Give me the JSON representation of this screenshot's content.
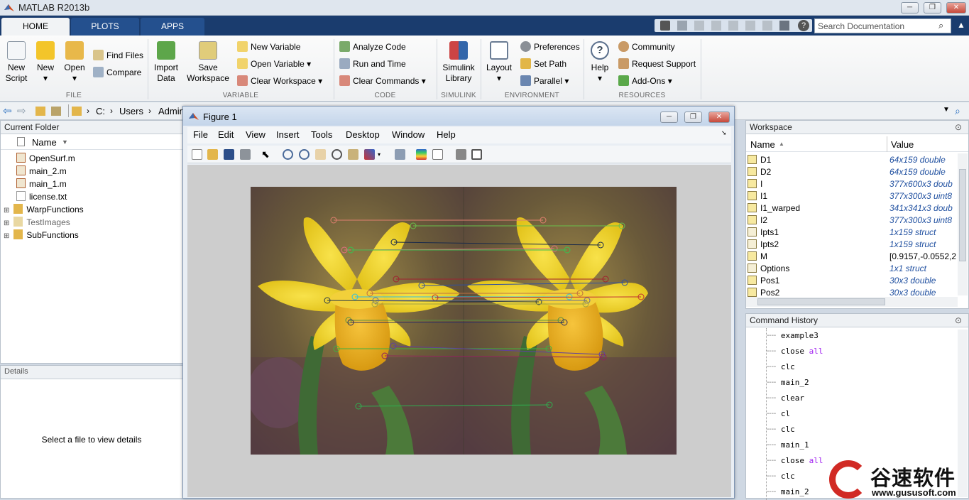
{
  "window": {
    "title": "MATLAB R2013b"
  },
  "tabs": [
    {
      "label": "HOME"
    },
    {
      "label": "PLOTS"
    },
    {
      "label": "APPS"
    }
  ],
  "search": {
    "placeholder": "Search Documentation"
  },
  "ribbon": {
    "file": {
      "new_script": "New\nScript",
      "new": "New",
      "open": "Open",
      "find_files": "Find Files",
      "compare": "Compare",
      "label": "FILE"
    },
    "variable": {
      "import_data": "Import\nData",
      "save_workspace": "Save\nWorkspace",
      "new_variable": "New Variable",
      "open_variable": "Open Variable",
      "clear_workspace": "Clear Workspace",
      "label": "VARIABLE"
    },
    "code": {
      "analyze": "Analyze Code",
      "run_time": "Run and Time",
      "clear_commands": "Clear Commands",
      "label": "CODE"
    },
    "simulink": {
      "library": "Simulink\nLibrary",
      "label": "SIMULINK"
    },
    "environment": {
      "layout": "Layout",
      "preferences": "Preferences",
      "set_path": "Set Path",
      "parallel": "Parallel",
      "label": "ENVIRONMENT"
    },
    "resources": {
      "help": "Help",
      "community": "Community",
      "request_support": "Request Support",
      "add_ons": "Add-Ons",
      "label": "RESOURCES"
    }
  },
  "address": {
    "parts": [
      "C:",
      "Users",
      "Admin"
    ]
  },
  "current_folder": {
    "title": "Current Folder",
    "col_name": "Name",
    "files": [
      {
        "name": "OpenSurf.m",
        "type": "m"
      },
      {
        "name": "main_2.m",
        "type": "m"
      },
      {
        "name": "main_1.m",
        "type": "m"
      },
      {
        "name": "license.txt",
        "type": "txt"
      },
      {
        "name": "WarpFunctions",
        "type": "folder"
      },
      {
        "name": "TestImages",
        "type": "folder-gray"
      },
      {
        "name": "SubFunctions",
        "type": "folder"
      }
    ]
  },
  "details": {
    "title": "Details",
    "message": "Select a file to view details"
  },
  "figure": {
    "title": "Figure 1",
    "menus": [
      "File",
      "Edit",
      "View",
      "Insert",
      "Tools",
      "Desktop",
      "Window",
      "Help"
    ]
  },
  "workspace": {
    "title": "Workspace",
    "col_name": "Name",
    "col_value": "Value",
    "rows": [
      {
        "name": "D1",
        "value": "64x159 double"
      },
      {
        "name": "D2",
        "value": "64x159 double"
      },
      {
        "name": "I",
        "value": "377x600x3 doub"
      },
      {
        "name": "I1",
        "value": "377x300x3 uint8"
      },
      {
        "name": "I1_warped",
        "value": "341x341x3 doub"
      },
      {
        "name": "I2",
        "value": "377x300x3 uint8"
      },
      {
        "name": "Ipts1",
        "value": "1x159 struct"
      },
      {
        "name": "Ipts2",
        "value": "1x159 struct"
      },
      {
        "name": "M",
        "value": "[0.9157,-0.0552,2"
      },
      {
        "name": "Options",
        "value": "1x1 struct"
      },
      {
        "name": "Pos1",
        "value": "30x3 double"
      },
      {
        "name": "Pos2",
        "value": "30x3 double"
      }
    ]
  },
  "history": {
    "title": "Command History",
    "commands": [
      {
        "cmd": "example3",
        "kw": ""
      },
      {
        "cmd": "close ",
        "kw": "all"
      },
      {
        "cmd": "clc",
        "kw": ""
      },
      {
        "cmd": "main_2",
        "kw": ""
      },
      {
        "cmd": "clear",
        "kw": ""
      },
      {
        "cmd": "cl",
        "kw": ""
      },
      {
        "cmd": "clc",
        "kw": ""
      },
      {
        "cmd": "main_1",
        "kw": ""
      },
      {
        "cmd": "close ",
        "kw": "all"
      },
      {
        "cmd": "clc",
        "kw": ""
      },
      {
        "cmd": "main_2",
        "kw": ""
      }
    ]
  },
  "watermark": {
    "brand": "谷速软件",
    "url": "www.gususoft.com"
  },
  "colors": {
    "accent": "#1a3c6e",
    "link": "#2050a0"
  }
}
